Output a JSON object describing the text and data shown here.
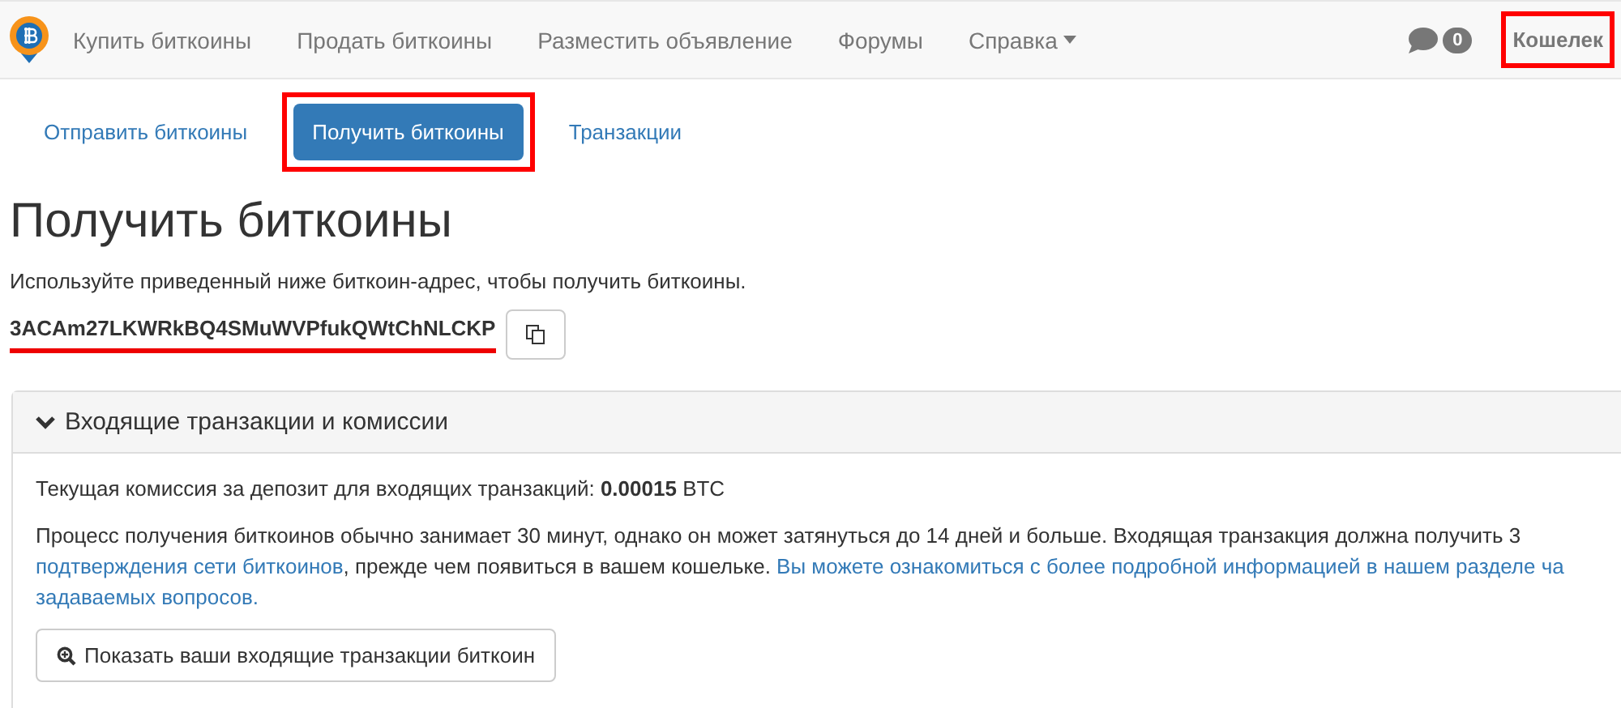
{
  "navbar": {
    "items": [
      {
        "label": "Купить биткоины",
        "dropdown": false
      },
      {
        "label": "Продать биткоины",
        "dropdown": false
      },
      {
        "label": "Разместить объявление",
        "dropdown": false
      },
      {
        "label": "Форумы",
        "dropdown": false
      },
      {
        "label": "Справка",
        "dropdown": true
      }
    ],
    "messages_count": "0",
    "wallet": {
      "label": "Кошелек",
      "highlighted": true
    }
  },
  "tabs": [
    {
      "label": "Отправить биткоины",
      "selected": false,
      "highlighted": false
    },
    {
      "label": "Получить биткоины",
      "selected": true,
      "highlighted": true
    },
    {
      "label": "Транзакции",
      "selected": false,
      "highlighted": false
    }
  ],
  "title": "Получить биткоины",
  "intro": "Используйте приведенный ниже биткоин-адрес, чтобы получить биткоины.",
  "address": {
    "value": "3ACAm27LKWRkBQ4SMuWVPfukQWtChNLCKP",
    "underlined": true
  },
  "panel": {
    "title": "Входящие транзакции и комиссии",
    "expanded": true,
    "fee": "Текущая комиссия за депозит для входящих транзакций: **0.00015** BTC",
    "paragraph": [
      [
        {
          "text": "Процесс получения биткоинов обычно занимает 30 минут, однако он может затянуться до 14 дней и больше. Входящая транзакция должна получить 3",
          "link": false
        }
      ],
      [
        {
          "text": "подтверждения сети биткоинов",
          "link": true
        },
        {
          "text": ", прежде чем появиться в вашем кошельке. ",
          "link": false
        },
        {
          "text": "Вы можете ознакомиться с более подробной информацией в нашем разделе ча",
          "link": true
        }
      ],
      [
        {
          "text": "задаваемых вопросов.",
          "link": true
        }
      ]
    ],
    "button": "Показать ваши входящие транзакции биткоин"
  }
}
